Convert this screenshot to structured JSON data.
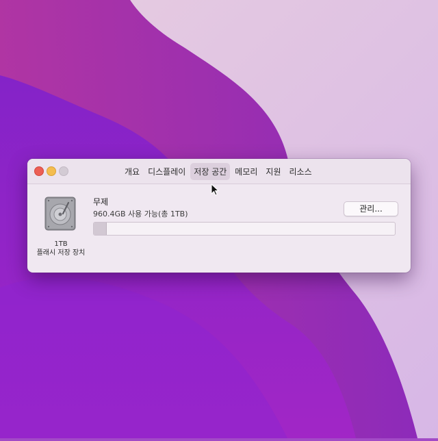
{
  "window": {
    "tabs": [
      {
        "label": "개요",
        "active": false
      },
      {
        "label": "디스플레이",
        "active": false
      },
      {
        "label": "저장 공간",
        "active": true
      },
      {
        "label": "메모리",
        "active": false
      },
      {
        "label": "지원",
        "active": false
      },
      {
        "label": "리소스",
        "active": false
      }
    ]
  },
  "storage": {
    "device_capacity": "1TB",
    "device_type": "플래시 저장 장치",
    "volume_name": "무제",
    "available_text": "960.4GB 사용 가능(총 1TB)",
    "used_fraction": 0.04,
    "manage_button_label": "관리..."
  },
  "colors": {
    "close": "#ec5f55",
    "minimize": "#f4bd4f",
    "zoom_disabled": "#d3cbd4",
    "window_bg": "#f0e8f1"
  },
  "icons": {
    "device": "hard-drive-icon",
    "pointer": "mouse-pointer-icon"
  }
}
